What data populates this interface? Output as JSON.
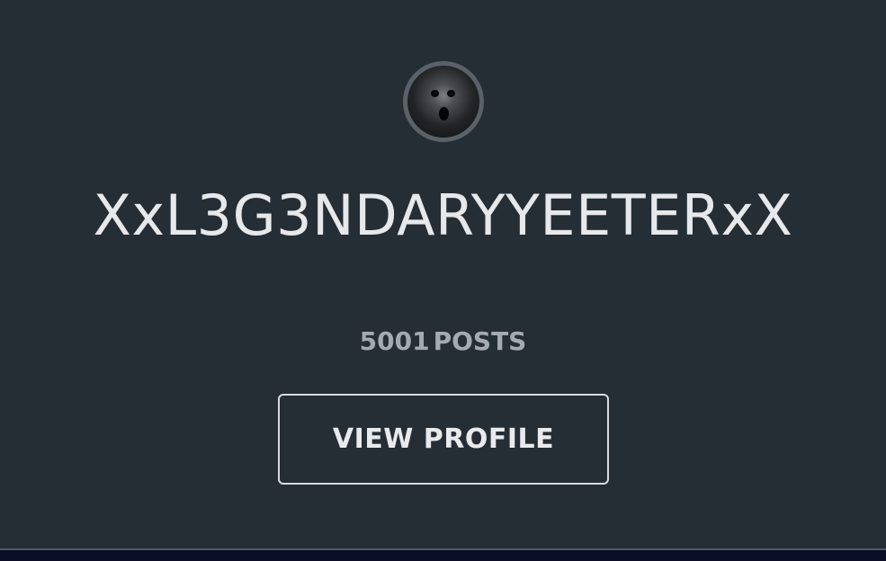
{
  "profile": {
    "avatar_icon": "ghost-face-avatar",
    "username": "XxL3G3NDARYYEETERxX",
    "post_count": "5001",
    "posts_label": "POSTS",
    "view_profile_label": "VIEW PROFILE"
  },
  "colors": {
    "background": "#252d35",
    "username_text": "#e6e8ea",
    "posts_text": "#a4aab0",
    "button_border": "#d9dcdf",
    "bottom_bar": "#0b0d24"
  }
}
